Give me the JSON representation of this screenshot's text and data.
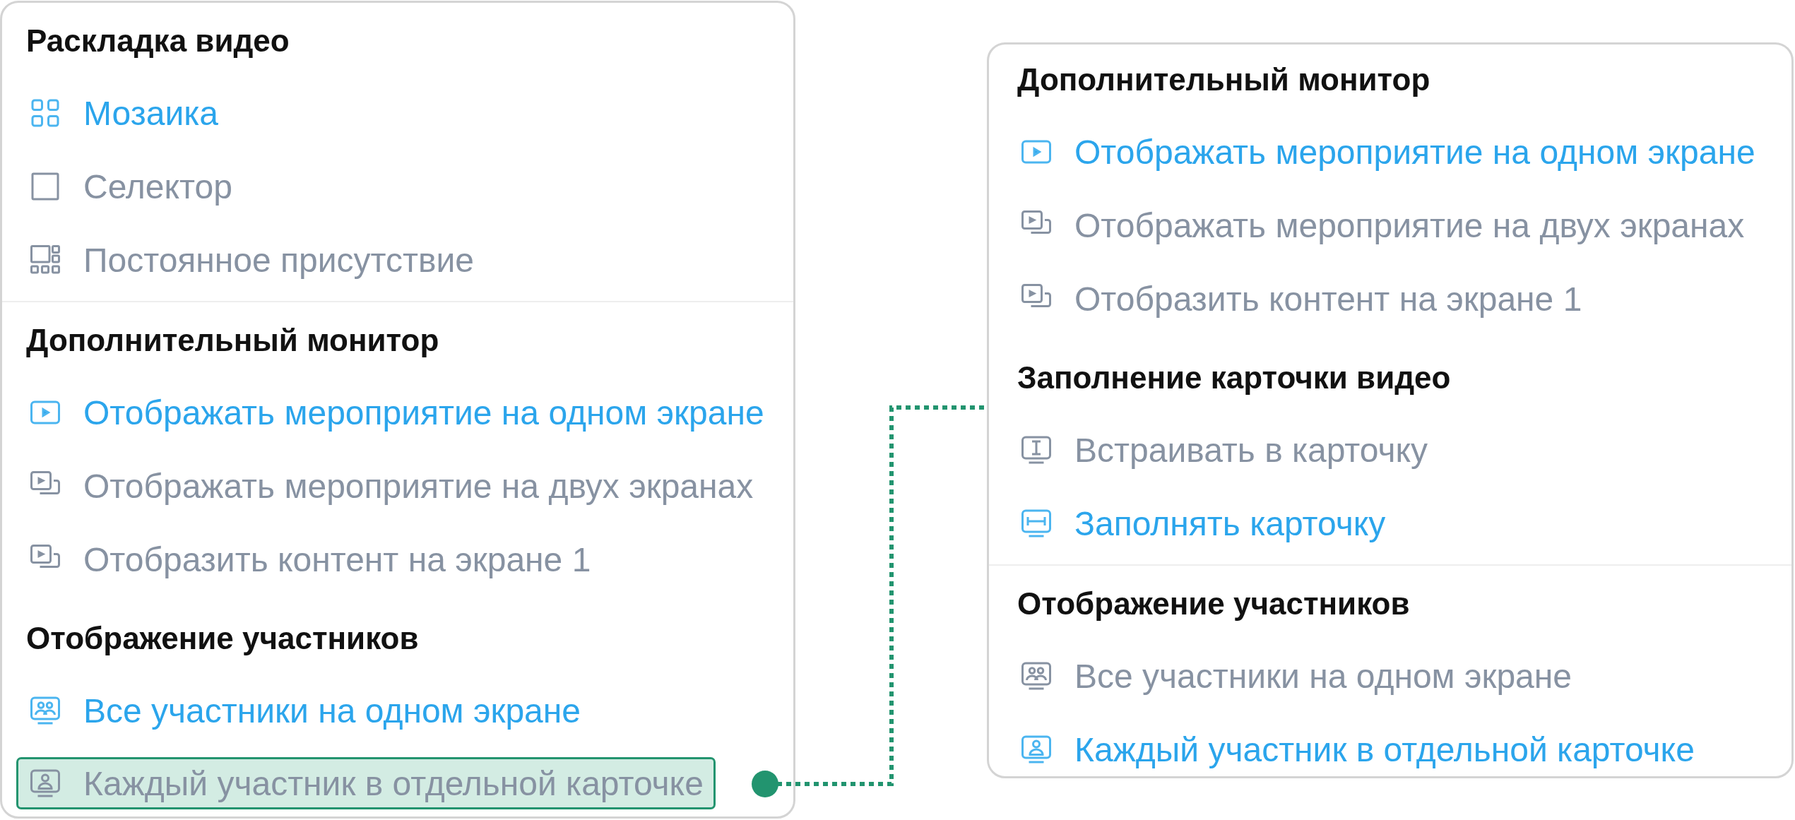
{
  "panels": [
    {
      "sections": [
        {
          "title": "Раскладка видео",
          "divider_after": true,
          "items": [
            {
              "kind": "grid",
              "label": "Мозаика",
              "selected": true,
              "highlighted": false
            },
            {
              "kind": "square",
              "label": "Селектор",
              "selected": false,
              "highlighted": false
            },
            {
              "kind": "presence",
              "label": "Постоянное присутствие",
              "selected": false,
              "highlighted": false
            }
          ]
        },
        {
          "title": "Дополнительный монитор",
          "divider_after": false,
          "items": [
            {
              "kind": "play",
              "label": "Отображать мероприятие на одном экране",
              "selected": true,
              "highlighted": false
            },
            {
              "kind": "dual",
              "label": "Отображать мероприятие на двух экранах",
              "selected": false,
              "highlighted": false
            },
            {
              "kind": "dual",
              "label": "Отобразить контент на экране 1",
              "selected": false,
              "highlighted": false
            }
          ]
        },
        {
          "title": "Отображение участников",
          "divider_after": false,
          "items": [
            {
              "kind": "group",
              "label": "Все участники на одном экране",
              "selected": true,
              "highlighted": false
            },
            {
              "kind": "person",
              "label": "Каждый участник в отдельной карточке",
              "selected": false,
              "highlighted": true
            }
          ]
        }
      ]
    },
    {
      "sections": [
        {
          "title": "Дополнительный монитор",
          "divider_after": false,
          "items": [
            {
              "kind": "play",
              "label": "Отображать мероприятие на одном экране",
              "selected": true,
              "highlighted": false
            },
            {
              "kind": "dual",
              "label": "Отображать мероприятие на двух экранах",
              "selected": false,
              "highlighted": false
            },
            {
              "kind": "dual",
              "label": "Отобразить контент на экране 1",
              "selected": false,
              "highlighted": false
            }
          ]
        },
        {
          "title": "Заполнение карточки видео",
          "divider_after": true,
          "items": [
            {
              "kind": "fit-vertical",
              "label": "Встраивать в карточку",
              "selected": false,
              "highlighted": false
            },
            {
              "kind": "fit-horizontal",
              "label": "Заполнять карточку",
              "selected": true,
              "highlighted": false
            }
          ]
        },
        {
          "title": "Отображение участников",
          "divider_after": false,
          "items": [
            {
              "kind": "group",
              "label": "Все участники на одном экране",
              "selected": false,
              "highlighted": false
            },
            {
              "kind": "person",
              "label": "Каждый участник в отдельной карточке",
              "selected": true,
              "highlighted": false
            }
          ]
        }
      ]
    }
  ]
}
